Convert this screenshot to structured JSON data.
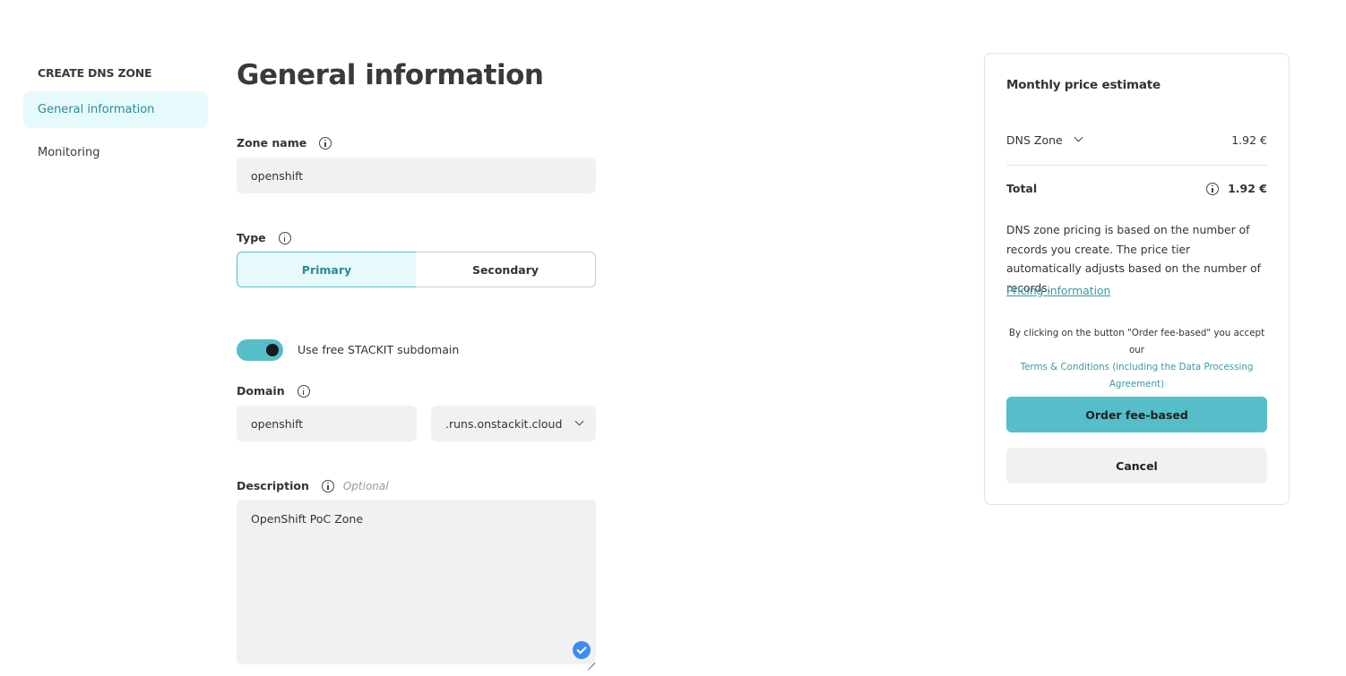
{
  "sidebar": {
    "heading": "CREATE DNS ZONE",
    "items": [
      {
        "label": "General information",
        "active": true
      },
      {
        "label": "Monitoring",
        "active": false
      }
    ]
  },
  "main": {
    "title": "General information",
    "zone_name": {
      "label": "Zone name",
      "value": "openshift"
    },
    "type": {
      "label": "Type",
      "options": [
        "Primary",
        "Secondary"
      ],
      "selected": "Primary"
    },
    "subdomain_toggle": {
      "label": "Use free STACKIT subdomain",
      "on": true
    },
    "domain": {
      "label": "Domain",
      "value": "openshift",
      "suffix": ".runs.onstackit.cloud"
    },
    "description": {
      "label": "Description",
      "optional_text": "Optional",
      "value": "OpenShift PoC Zone"
    }
  },
  "price_panel": {
    "title": "Monthly price estimate",
    "dns_zone_label": "DNS Zone",
    "dns_zone_price": "1.92 €",
    "total_label": "Total",
    "total_price": "1.92 €",
    "description": "DNS zone pricing is based on the number of records you create. The price tier automatically adjusts based on the number of records.",
    "pricing_link": "Pricing information",
    "terms_prefix": "By clicking on the button \"Order fee-based\" you accept our",
    "terms_link": "Terms & Conditions (including the Data Processing Agreement)",
    "order_button": "Order fee-based",
    "cancel_button": "Cancel"
  },
  "colors": {
    "accent": "#55bec8",
    "accent_light": "#e6fafb",
    "link": "#3a9aa3",
    "input_bg": "#f0f1f2",
    "check_badge": "#3e8cf0"
  }
}
